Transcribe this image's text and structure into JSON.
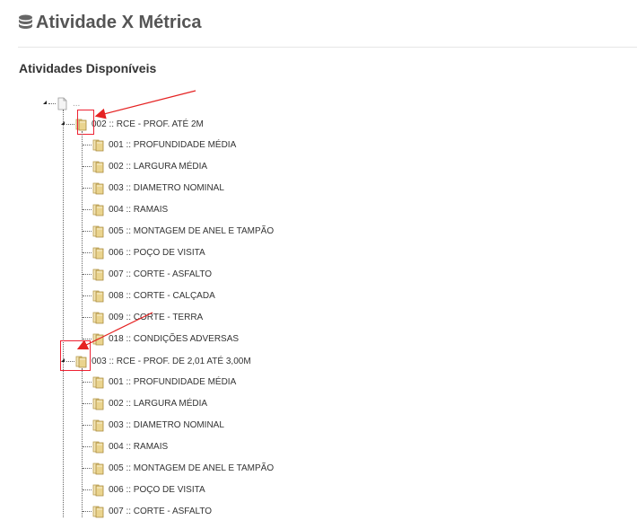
{
  "header": {
    "title": "Atividade X Métrica",
    "icon": "database-icon"
  },
  "section": {
    "title": "Atividades Disponíveis"
  },
  "tree": {
    "root_label": "...",
    "groups": [
      {
        "label": "002 :: RCE - PROF. ATÉ 2M",
        "children": [
          "001 :: PROFUNDIDADE MÉDIA",
          "002 :: LARGURA MÉDIA",
          "003 :: DIAMETRO NOMINAL",
          "004 :: RAMAIS",
          "005 :: MONTAGEM DE ANEL E TAMPÃO",
          "006 :: POÇO DE VISITA",
          "007 :: CORTE - ASFALTO",
          "008 :: CORTE - CALÇADA",
          "009 :: CORTE - TERRA",
          "018 :: CONDIÇÕES ADVERSAS"
        ]
      },
      {
        "label": "003 :: RCE - PROF. DE 2,01 ATÉ 3,00M",
        "children": [
          "001 :: PROFUNDIDADE MÉDIA",
          "002 :: LARGURA MÉDIA",
          "003 :: DIAMETRO NOMINAL",
          "004 :: RAMAIS",
          "005 :: MONTAGEM DE ANEL E TAMPÃO",
          "006 :: POÇO DE VISITA",
          "007 :: CORTE - ASFALTO"
        ]
      }
    ]
  },
  "colors": {
    "annotation": "#e52222",
    "folder": "#e8d38a"
  }
}
